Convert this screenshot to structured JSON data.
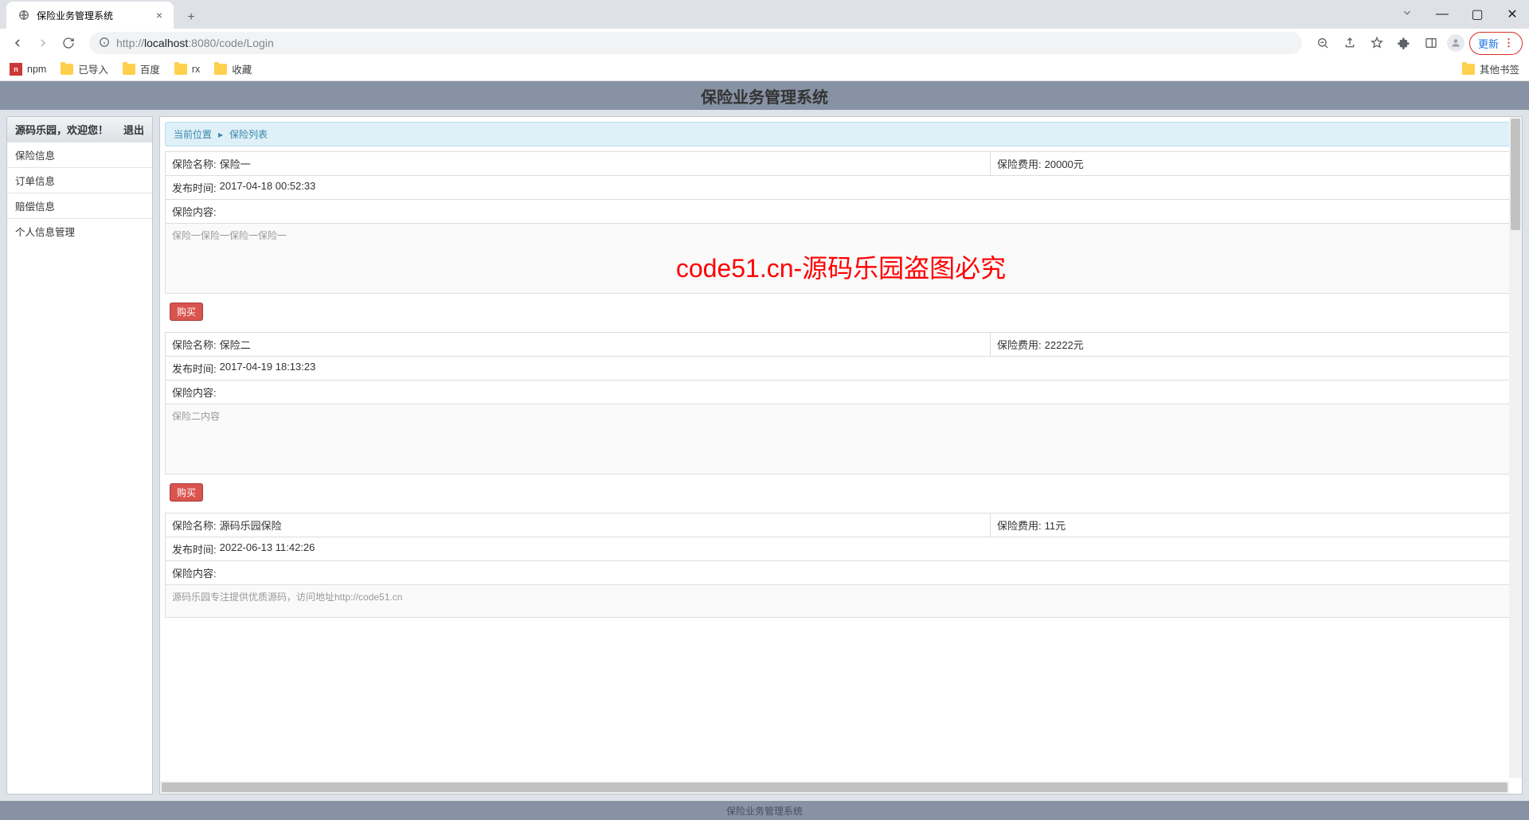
{
  "browser": {
    "tab_title": "保险业务管理系统",
    "url_grey1": "http://",
    "url_dark": "localhost",
    "url_grey2": ":8080/code/Login",
    "update_label": "更新",
    "bookmarks": [
      {
        "type": "npm",
        "label": "npm"
      },
      {
        "type": "folder",
        "label": "已导入"
      },
      {
        "type": "folder",
        "label": "百度"
      },
      {
        "type": "folder",
        "label": "rx"
      },
      {
        "type": "folder",
        "label": "收藏"
      }
    ],
    "other_bookmarks": "其他书签"
  },
  "app": {
    "title": "保险业务管理系统",
    "footer": "保险业务管理系统",
    "watermark": "code51.cn-源码乐园盗图必究"
  },
  "sidebar": {
    "welcome": "源码乐园，欢迎您！",
    "logout": "退出",
    "items": [
      "保险信息",
      "订单信息",
      "赔偿信息",
      "个人信息管理"
    ]
  },
  "breadcrumb": {
    "current_label": "当前位置",
    "page": "保险列表"
  },
  "labels": {
    "name": "保险名称:",
    "fee": "保险费用:",
    "publish": "发布时间:",
    "content": "保险内容:",
    "buy": "购买"
  },
  "items": [
    {
      "name": "保险一",
      "fee": "20000元",
      "publish": "2017-04-18 00:52:33",
      "content": "保险一保险一保险一保险一"
    },
    {
      "name": "保险二",
      "fee": "22222元",
      "publish": "2017-04-19 18:13:23",
      "content": "保险二内容"
    },
    {
      "name": "源码乐园保险",
      "fee": "11元",
      "publish": "2022-06-13 11:42:26",
      "content": "源码乐园专注提供优质源码，访问地址http://code51.cn"
    }
  ]
}
